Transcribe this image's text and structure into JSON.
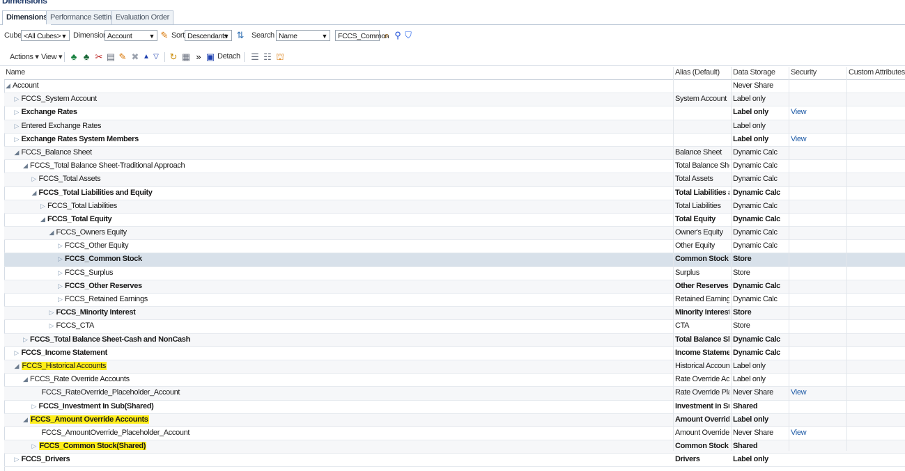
{
  "header": {
    "title": "Dimensions"
  },
  "tabs": [
    {
      "label": "Dimensions",
      "active": true
    },
    {
      "label": "Performance Settings",
      "active": false
    },
    {
      "label": "Evaluation Order",
      "active": false
    }
  ],
  "toolbar1": {
    "cube_label": "Cube",
    "cube_value": "<All Cubes>",
    "dimension_label": "Dimension",
    "dimension_value": "Account",
    "sort_label": "Sort",
    "sort_value": "Descendants",
    "search_label": "Search",
    "search_value": "Name",
    "search_text": "FCCS_Common"
  },
  "toolbar2": {
    "actions_label": "Actions",
    "view_label": "View",
    "detach_label": "Detach"
  },
  "columns": {
    "name": "Name",
    "alias": "Alias (Default)",
    "storage": "Data Storage",
    "security": "Security",
    "attributes": "Custom Attributes"
  },
  "rows": [
    {
      "name": "Account",
      "alias": "",
      "storage": "Never Share",
      "security": "",
      "indent": 0,
      "tw": "open",
      "bold": false,
      "hl": false
    },
    {
      "name": "FCCS_System Account",
      "alias": "System Account",
      "storage": "Label only",
      "security": "",
      "indent": 1,
      "tw": "closed",
      "bold": false,
      "hl": false
    },
    {
      "name": "Exchange Rates",
      "alias": "",
      "storage": "Label only",
      "security": "View",
      "indent": 1,
      "tw": "closed",
      "bold": true,
      "hl": false
    },
    {
      "name": "Entered Exchange Rates",
      "alias": "",
      "storage": "Label only",
      "security": "",
      "indent": 1,
      "tw": "closed",
      "bold": false,
      "hl": false
    },
    {
      "name": "Exchange Rates System Members",
      "alias": "",
      "storage": "Label only",
      "security": "View",
      "indent": 1,
      "tw": "closed",
      "bold": true,
      "hl": false
    },
    {
      "name": "FCCS_Balance Sheet",
      "alias": "Balance Sheet",
      "storage": "Dynamic Calc",
      "security": "",
      "indent": 1,
      "tw": "open",
      "bold": false,
      "hl": false
    },
    {
      "name": "FCCS_Total Balance Sheet-Traditional Approach",
      "alias": "Total Balance She...",
      "storage": "Dynamic Calc",
      "security": "",
      "indent": 2,
      "tw": "open",
      "bold": false,
      "hl": false
    },
    {
      "name": "FCCS_Total Assets",
      "alias": "Total Assets",
      "storage": "Dynamic Calc",
      "security": "",
      "indent": 3,
      "tw": "closed",
      "bold": false,
      "hl": false
    },
    {
      "name": "FCCS_Total Liabilities and Equity",
      "alias": "Total Liabilities an...",
      "storage": "Dynamic Calc",
      "security": "",
      "indent": 3,
      "tw": "open",
      "bold": true,
      "hl": false
    },
    {
      "name": "FCCS_Total Liabilities",
      "alias": "Total Liabilities",
      "storage": "Dynamic Calc",
      "security": "",
      "indent": 4,
      "tw": "closed",
      "bold": false,
      "hl": false
    },
    {
      "name": "FCCS_Total Equity",
      "alias": "Total Equity",
      "storage": "Dynamic Calc",
      "security": "",
      "indent": 4,
      "tw": "open",
      "bold": true,
      "hl": false
    },
    {
      "name": "FCCS_Owners Equity",
      "alias": "Owner's Equity",
      "storage": "Dynamic Calc",
      "security": "",
      "indent": 5,
      "tw": "open",
      "bold": false,
      "hl": false
    },
    {
      "name": "FCCS_Other Equity",
      "alias": "Other Equity",
      "storage": "Dynamic Calc",
      "security": "",
      "indent": 6,
      "tw": "closed",
      "bold": false,
      "hl": false
    },
    {
      "name": "FCCS_Common Stock",
      "alias": "Common Stock",
      "storage": "Store",
      "security": "",
      "indent": 6,
      "tw": "closed",
      "bold": true,
      "hl": false,
      "selected": true
    },
    {
      "name": "FCCS_Surplus",
      "alias": "Surplus",
      "storage": "Store",
      "security": "",
      "indent": 6,
      "tw": "closed",
      "bold": false,
      "hl": false
    },
    {
      "name": "FCCS_Other Reserves",
      "alias": "Other Reserves",
      "storage": "Dynamic Calc",
      "security": "",
      "indent": 6,
      "tw": "closed",
      "bold": true,
      "hl": false
    },
    {
      "name": "FCCS_Retained Earnings",
      "alias": "Retained Earnings",
      "storage": "Dynamic Calc",
      "security": "",
      "indent": 6,
      "tw": "closed",
      "bold": false,
      "hl": false
    },
    {
      "name": "FCCS_Minority Interest",
      "alias": "Minority Interest",
      "storage": "Store",
      "security": "",
      "indent": 5,
      "tw": "closed",
      "bold": true,
      "hl": false
    },
    {
      "name": "FCCS_CTA",
      "alias": "CTA",
      "storage": "Store",
      "security": "",
      "indent": 5,
      "tw": "closed",
      "bold": false,
      "hl": false
    },
    {
      "name": "FCCS_Total Balance Sheet-Cash and NonCash",
      "alias": "Total Balance She...",
      "storage": "Dynamic Calc",
      "security": "",
      "indent": 2,
      "tw": "closed",
      "bold": true,
      "hl": false
    },
    {
      "name": "FCCS_Income Statement",
      "alias": "Income Statement",
      "storage": "Dynamic Calc",
      "security": "",
      "indent": 1,
      "tw": "closed",
      "bold": true,
      "hl": false
    },
    {
      "name": "FCCS_Historical Accounts",
      "alias": "Historical Accounts",
      "storage": "Label only",
      "security": "",
      "indent": 1,
      "tw": "open",
      "bold": false,
      "hl": true
    },
    {
      "name": "FCCS_Rate Override Accounts",
      "alias": "Rate Override Acc...",
      "storage": "Label only",
      "security": "",
      "indent": 2,
      "tw": "open",
      "bold": false,
      "hl": false
    },
    {
      "name": "FCCS_RateOverride_Placeholder_Account",
      "alias": "Rate Override Plac...",
      "storage": "Never Share",
      "security": "View",
      "indent": 3,
      "tw": "none",
      "bold": false,
      "hl": false
    },
    {
      "name": "FCCS_Investment In Sub(Shared)",
      "alias": "Investment in Sub",
      "storage": "Shared",
      "security": "",
      "indent": 3,
      "tw": "closed",
      "bold": true,
      "hl": false
    },
    {
      "name": "FCCS_Amount Override Accounts",
      "alias": "Amount Override ...",
      "storage": "Label only",
      "security": "",
      "indent": 2,
      "tw": "open",
      "bold": true,
      "hl": true
    },
    {
      "name": "FCCS_AmountOverride_Placeholder_Account",
      "alias": "Amount Override ...",
      "storage": "Never Share",
      "security": "View",
      "indent": 3,
      "tw": "none",
      "bold": false,
      "hl": false
    },
    {
      "name": "FCCS_Common Stock(Shared)",
      "alias": "Common Stock",
      "storage": "Shared",
      "security": "",
      "indent": 3,
      "tw": "closed",
      "bold": true,
      "hl": true
    },
    {
      "name": "FCCS_Drivers",
      "alias": "Drivers",
      "storage": "Label only",
      "security": "",
      "indent": 1,
      "tw": "closed",
      "bold": true,
      "hl": false
    }
  ]
}
